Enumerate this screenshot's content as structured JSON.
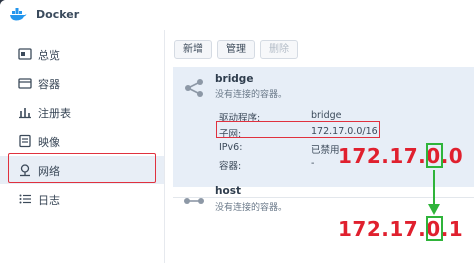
{
  "window": {
    "title": "Docker"
  },
  "sidebar": {
    "items": [
      {
        "label": "总览",
        "icon": "overview-icon"
      },
      {
        "label": "容器",
        "icon": "container-icon"
      },
      {
        "label": "注册表",
        "icon": "registry-icon"
      },
      {
        "label": "映像",
        "icon": "image-icon"
      },
      {
        "label": "网络",
        "icon": "network-icon",
        "active": true
      },
      {
        "label": "日志",
        "icon": "log-icon"
      }
    ]
  },
  "toolbar": {
    "add_label": "新增",
    "manage_label": "管理",
    "delete_label": "删除"
  },
  "networks": [
    {
      "name": "bridge",
      "subtitle": "没有连接的容器。",
      "details": [
        {
          "label": "驱动程序:",
          "value": "bridge"
        },
        {
          "label": "子网:",
          "value": "172.17.0.0/16"
        },
        {
          "label": "IPv6:",
          "value": "已禁用"
        },
        {
          "label": "容器:",
          "value": "-"
        }
      ]
    },
    {
      "name": "host",
      "subtitle": "没有连接的容器。"
    }
  ],
  "annotations": {
    "ip_before": "172.17.0.0",
    "ip_after": "172.17.0.1",
    "box_color": "#2fb43a",
    "text_color": "#e0202e"
  }
}
